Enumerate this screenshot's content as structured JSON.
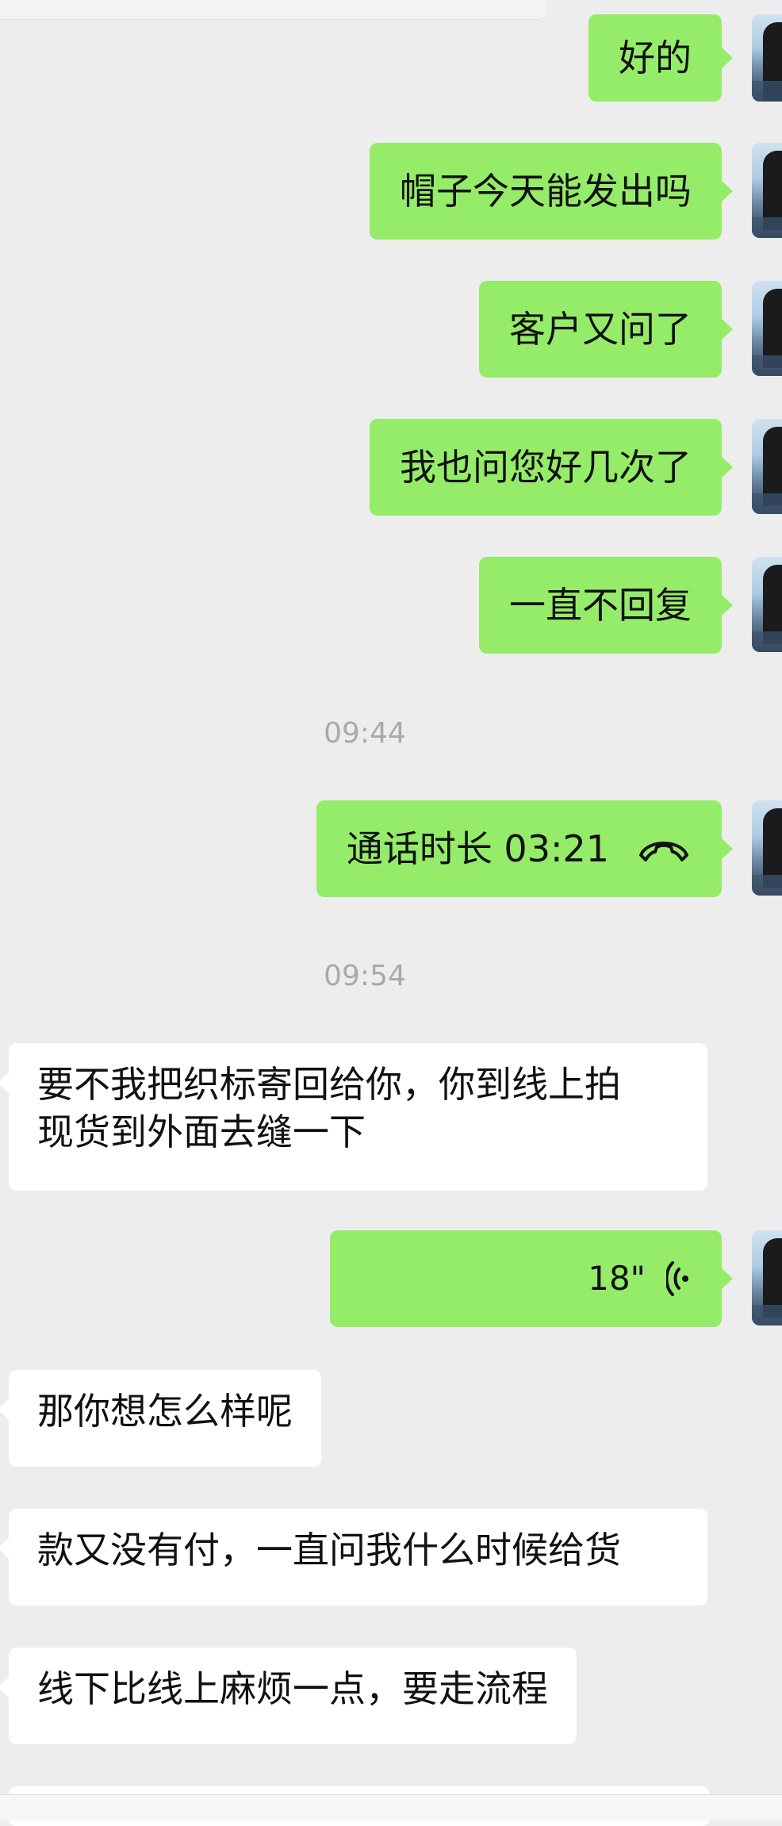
{
  "messages": {
    "m1": "好的",
    "m2": "帽子今天能发出吗",
    "m3": "客户又问了",
    "m4": "我也问您好几次了",
    "m5": "一直不回复",
    "call_label": "通话时长 03:21",
    "m6_line1": "要不我把织标寄回给你，你到线上拍",
    "m6_line2": "现货到外面去缝一下",
    "voice_duration": "18\"",
    "m7": "那你想怎么样呢",
    "m8": "款又没有付，一直问我什么时候给货",
    "m9": "线下比线上麻烦一点，要走流程"
  },
  "timestamps": {
    "t1": "09:44",
    "t2": "09:54"
  },
  "icons": {
    "call": "phone-hangup-icon",
    "voice": "voice-wave-icon"
  },
  "colors": {
    "outgoing_bubble": "#95ec69",
    "incoming_bubble": "#ffffff",
    "background": "#ededed",
    "timestamp": "#a9a9a9"
  }
}
